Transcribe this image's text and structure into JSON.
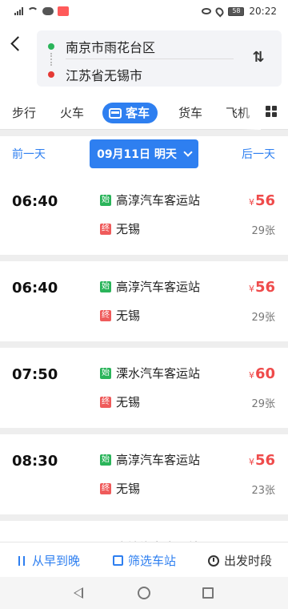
{
  "status_bar": {
    "time": "20:22",
    "battery": "58"
  },
  "route": {
    "from": "南京市雨花台区",
    "to": "江苏省无锡市"
  },
  "tabs": [
    "步行",
    "火车",
    "客车",
    "货车",
    "飞机"
  ],
  "date_bar": {
    "prev_label": "前一天",
    "next_label": "后一天",
    "current": "09月11日 明天"
  },
  "trips": [
    {
      "time": "06:40",
      "start_tag": "始",
      "start": "高淳汽车客运站",
      "end_tag": "终",
      "end": "无锡",
      "currency": "¥",
      "price": "56",
      "seats": "29张"
    },
    {
      "time": "06:40",
      "start_tag": "始",
      "start": "高淳汽车客运站",
      "end_tag": "终",
      "end": "无锡",
      "currency": "¥",
      "price": "56",
      "seats": "29张"
    },
    {
      "time": "07:50",
      "start_tag": "始",
      "start": "溧水汽车客运站",
      "end_tag": "终",
      "end": "无锡",
      "currency": "¥",
      "price": "60",
      "seats": "29张"
    },
    {
      "time": "08:30",
      "start_tag": "始",
      "start": "高淳汽车客运站",
      "end_tag": "终",
      "end": "无锡",
      "currency": "¥",
      "price": "56",
      "seats": "23张"
    },
    {
      "start_tag": "始",
      "start": "高淳汽车客运站"
    }
  ],
  "bottom_bar": {
    "sort": "从早到晚",
    "filter": "筛选车站",
    "depart": "出发时段"
  },
  "colors": {
    "accent": "#2e7ff0",
    "price": "#ef4b4b",
    "start_tag": "#2ab45a",
    "end_tag": "#ef5b5b"
  },
  "icons": [
    "back-arrow-icon",
    "swap-icon",
    "bus-icon",
    "grid-menu-icon",
    "chevron-down-icon",
    "sort-icon",
    "station-filter-icon",
    "clock-icon"
  ]
}
